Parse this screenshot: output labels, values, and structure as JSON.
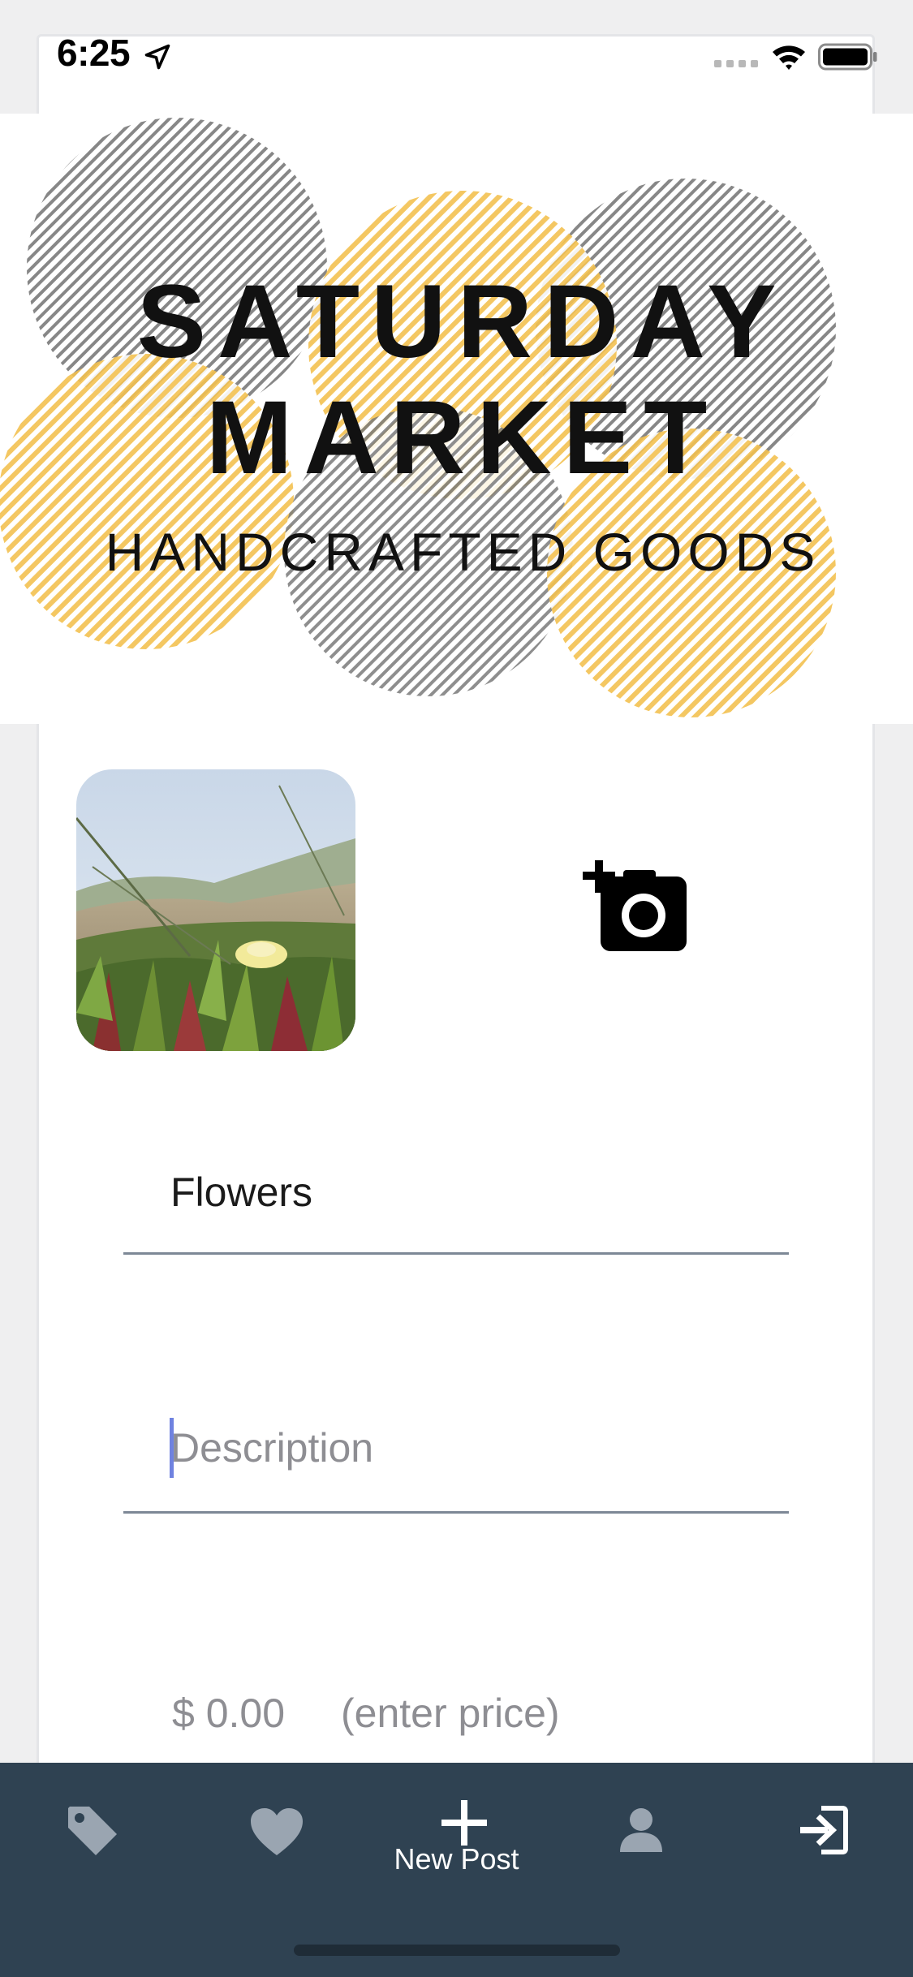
{
  "status_bar": {
    "time": "6:25",
    "icons": [
      "location-arrow-icon",
      "signal-icon",
      "wifi-icon",
      "battery-icon"
    ]
  },
  "banner": {
    "line1": "SATURDAY",
    "line2": "MARKET",
    "line3": "HANDCRAFTED GOODS",
    "colors": {
      "yellow": "#f3c150",
      "gray": "#8c8c8c"
    }
  },
  "photo": {
    "icon": "add-photo-camera-icon"
  },
  "form": {
    "name_value": "Flowers",
    "description_placeholder": "Description",
    "price_value": "$ 0.00",
    "price_hint": "(enter price)"
  },
  "tab_bar": {
    "background": "#2f4252",
    "tabs": [
      {
        "icon": "price-tag-icon",
        "label": ""
      },
      {
        "icon": "heart-icon",
        "label": ""
      },
      {
        "icon": "plus-icon",
        "label": "New Post"
      },
      {
        "icon": "user-icon",
        "label": ""
      },
      {
        "icon": "sign-out-icon",
        "label": ""
      }
    ]
  }
}
